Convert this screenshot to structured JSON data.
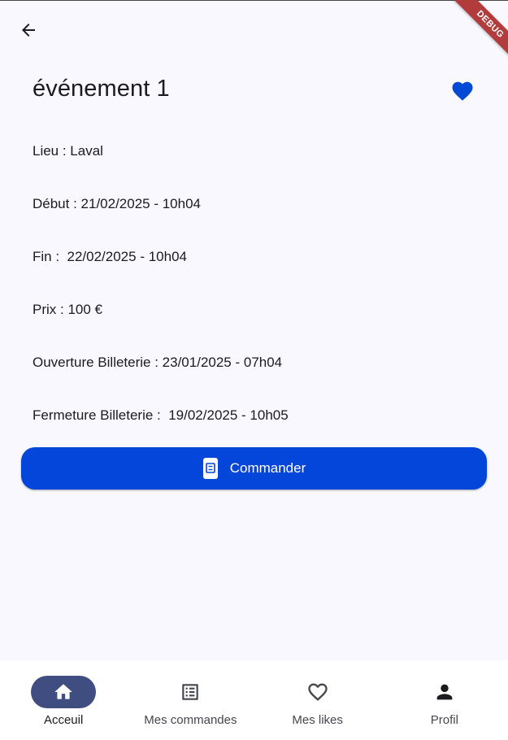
{
  "header": {
    "back_icon": "arrow-left-icon",
    "title": "événement 1",
    "like_icon": "heart-filled-icon"
  },
  "details": {
    "lieu": "Lieu : Laval",
    "debut": "Début : 21/02/2025 - 10h04",
    "fin": "Fin :  22/02/2025 - 10h04",
    "prix": "Prix : 100 €",
    "ouverture": "Ouverture Billeterie : 23/01/2025 - 07h04",
    "fermeture": "Fermeture Billeterie :  19/02/2025 - 10h05"
  },
  "order_button": {
    "label": "Commander",
    "icon": "receipt-icon"
  },
  "debug_banner": "DEBUG",
  "bottom_nav": {
    "active": "Acceuil",
    "items": [
      {
        "label": "Acceuil",
        "icon": "home-icon"
      },
      {
        "label": "Mes commandes",
        "icon": "list-alt-icon"
      },
      {
        "label": "Mes likes",
        "icon": "heart-outline-icon"
      },
      {
        "label": "Profil",
        "icon": "person-icon"
      }
    ]
  },
  "colors": {
    "background": "#f8f8fe",
    "primary": "#0346d9",
    "heart": "#0349d6",
    "nav_indicator": "#3f4d80",
    "debug_ribbon": "#b23b3b",
    "text": "#1c1b1f"
  }
}
